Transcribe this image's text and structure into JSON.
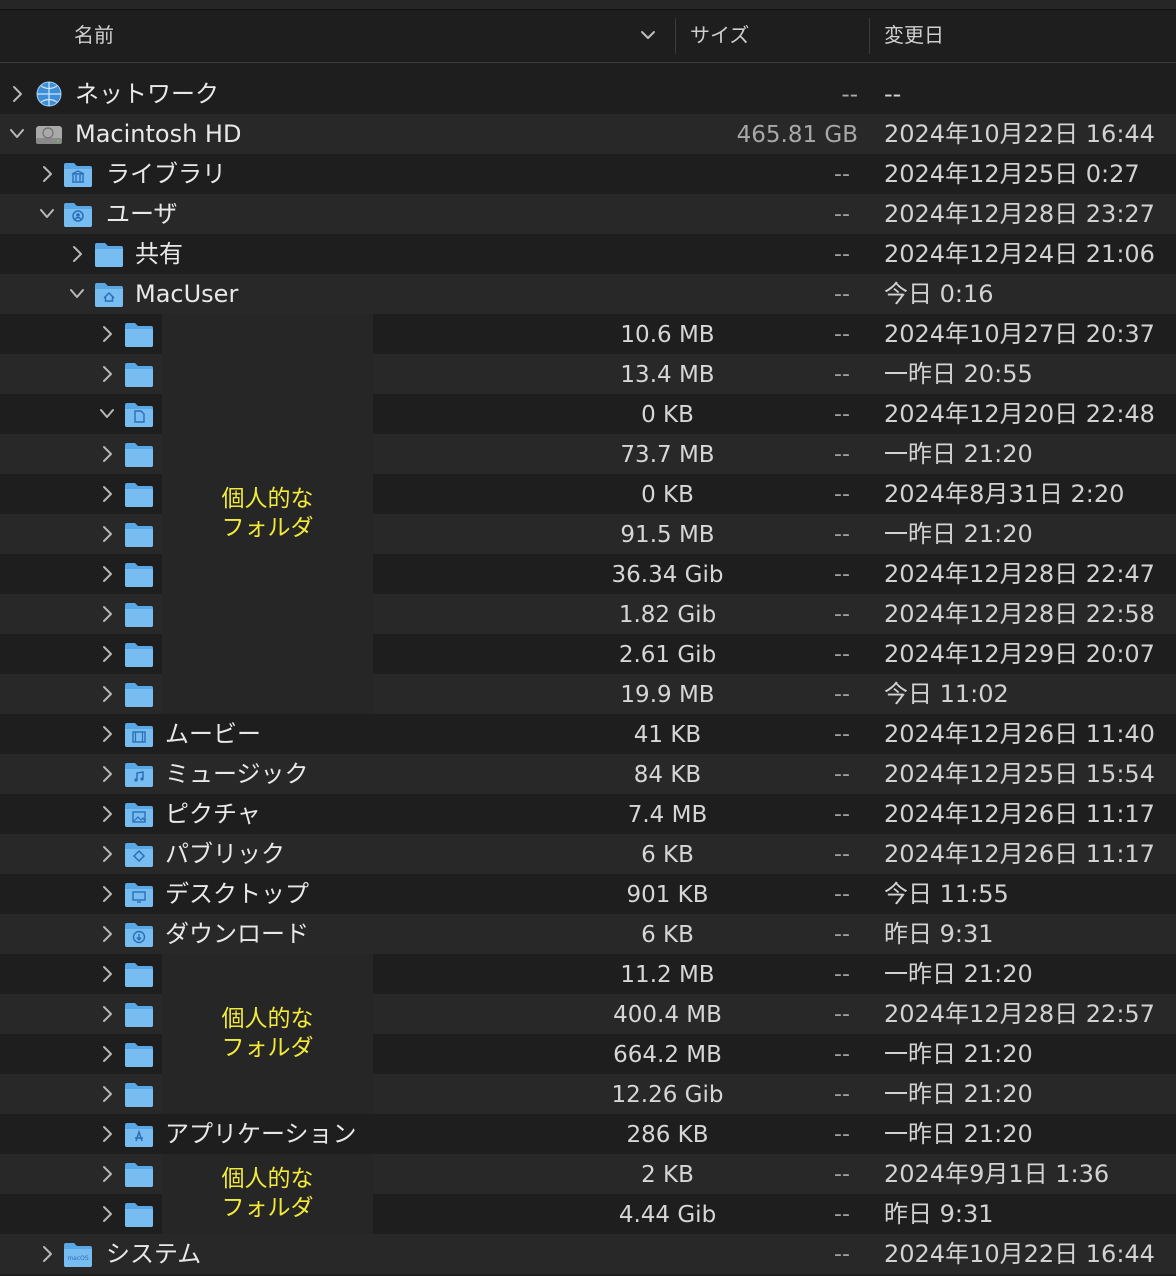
{
  "header": {
    "name": "名前",
    "size": "サイズ",
    "date": "変更日"
  },
  "redaction_label": [
    "個人的な",
    "フォルダ"
  ],
  "rows": [
    {
      "name": "ネットワーク",
      "size": "--",
      "date": "--",
      "level": 0,
      "expanded": false,
      "icon": "network-globe-icon",
      "dash": false,
      "size_right": true
    },
    {
      "name": "Macintosh HD",
      "size": "465.81 GB",
      "date": "2024年10月22日 16:44",
      "level": 0,
      "expanded": true,
      "icon": "hard-drive-icon",
      "dash": false,
      "size_right": true
    },
    {
      "name": "ライブラリ",
      "size": "",
      "date": "2024年12月25日 0:27",
      "level": 1,
      "expanded": false,
      "icon": "library-folder-icon",
      "dash": true
    },
    {
      "name": "ユーザ",
      "size": "",
      "date": "2024年12月28日 23:27",
      "level": 1,
      "expanded": true,
      "icon": "users-folder-icon",
      "dash": true
    },
    {
      "name": "共有",
      "size": "",
      "date": "2024年12月24日 21:06",
      "level": 2,
      "expanded": false,
      "icon": "folder-icon",
      "dash": true
    },
    {
      "name": "MacUser",
      "size": "",
      "date": "今日 0:16",
      "level": 2,
      "expanded": true,
      "icon": "home-folder-icon",
      "dash": true
    },
    {
      "name": "",
      "size": "10.6 MB",
      "date": "2024年10月27日 20:37",
      "level": 3,
      "expanded": false,
      "icon": "folder-icon",
      "dash": true
    },
    {
      "name": "",
      "size": "13.4 MB",
      "date": "一昨日 20:55",
      "level": 3,
      "expanded": false,
      "icon": "folder-icon",
      "dash": true
    },
    {
      "name": "",
      "size": "0 KB",
      "date": "2024年12月20日 22:48",
      "level": 3,
      "expanded": true,
      "icon": "documents-folder-icon",
      "dash": true
    },
    {
      "name": "",
      "size": "73.7 MB",
      "date": "一昨日 21:20",
      "level": 3,
      "expanded": false,
      "icon": "folder-icon",
      "dash": true
    },
    {
      "name": "",
      "size": "0 KB",
      "date": "2024年8月31日 2:20",
      "level": 3,
      "expanded": false,
      "icon": "folder-icon",
      "dash": true
    },
    {
      "name": "",
      "size": "91.5 MB",
      "date": "一昨日 21:20",
      "level": 3,
      "expanded": false,
      "icon": "folder-icon",
      "dash": true
    },
    {
      "name": "",
      "size": "36.34 Gib",
      "date": "2024年12月28日 22:47",
      "level": 3,
      "expanded": false,
      "icon": "folder-icon",
      "dash": true
    },
    {
      "name": "",
      "size": "1.82 Gib",
      "date": "2024年12月28日 22:58",
      "level": 3,
      "expanded": false,
      "icon": "folder-icon",
      "dash": true
    },
    {
      "name": "",
      "size": "2.61 Gib",
      "date": "2024年12月29日 20:07",
      "level": 3,
      "expanded": false,
      "icon": "folder-icon",
      "dash": true
    },
    {
      "name": "",
      "size": "19.9 MB",
      "date": "今日 11:02",
      "level": 3,
      "expanded": false,
      "icon": "folder-icon",
      "dash": true
    },
    {
      "name": "ムービー",
      "size": "41 KB",
      "date": "2024年12月26日 11:40",
      "level": 3,
      "expanded": false,
      "icon": "movies-folder-icon",
      "dash": true
    },
    {
      "name": "ミュージック",
      "size": "84 KB",
      "date": "2024年12月25日 15:54",
      "level": 3,
      "expanded": false,
      "icon": "music-folder-icon",
      "dash": true
    },
    {
      "name": "ピクチャ",
      "size": "7.4 MB",
      "date": "2024年12月26日 11:17",
      "level": 3,
      "expanded": false,
      "icon": "pictures-folder-icon",
      "dash": true
    },
    {
      "name": "パブリック",
      "size": "6 KB",
      "date": "2024年12月26日 11:17",
      "level": 3,
      "expanded": false,
      "icon": "public-folder-icon",
      "dash": true
    },
    {
      "name": "デスクトップ",
      "size": "901 KB",
      "date": "今日 11:55",
      "level": 3,
      "expanded": false,
      "icon": "desktop-folder-icon",
      "dash": true
    },
    {
      "name": "ダウンロード",
      "size": "6 KB",
      "date": "昨日 9:31",
      "level": 3,
      "expanded": false,
      "icon": "downloads-folder-icon",
      "dash": true
    },
    {
      "name": "",
      "size": "11.2 MB",
      "date": "一昨日 21:20",
      "level": 3,
      "expanded": false,
      "icon": "folder-icon",
      "dash": true
    },
    {
      "name": "",
      "size": "400.4 MB",
      "date": "2024年12月28日 22:57",
      "level": 3,
      "expanded": false,
      "icon": "folder-icon",
      "dash": true
    },
    {
      "name": "",
      "size": "664.2 MB",
      "date": "一昨日 21:20",
      "level": 3,
      "expanded": false,
      "icon": "folder-icon",
      "dash": true
    },
    {
      "name": "",
      "size": "12.26 Gib",
      "date": "一昨日 21:20",
      "level": 3,
      "expanded": false,
      "icon": "folder-icon",
      "dash": true
    },
    {
      "name": "アプリケーション",
      "size": "286 KB",
      "date": "一昨日 21:20",
      "level": 3,
      "expanded": false,
      "icon": "applications-folder-icon",
      "dash": true
    },
    {
      "name": "",
      "size": "2 KB",
      "date": "2024年9月1日 1:36",
      "level": 3,
      "expanded": false,
      "icon": "folder-icon",
      "dash": true
    },
    {
      "name": "",
      "size": "4.44 Gib",
      "date": "昨日 9:31",
      "level": 3,
      "expanded": false,
      "icon": "folder-icon",
      "dash": true
    },
    {
      "name": "システム",
      "size": "",
      "date": "2024年10月22日 16:44",
      "level": 1,
      "expanded": false,
      "icon": "macos-system-folder-icon",
      "dash": true
    }
  ]
}
